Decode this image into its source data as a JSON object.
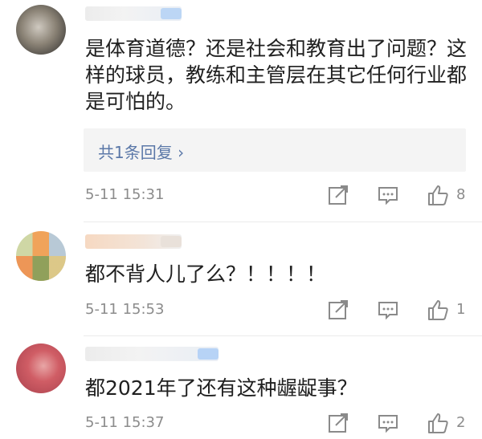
{
  "comments": [
    {
      "text": "是体育道德？还是社会和教育出了问题？这样的球员，教练和主管层在其它任何行业都是可怕的。",
      "reply_link": "共1条回复 ›",
      "time": "5-11 15:31",
      "likes": "8"
    },
    {
      "text": "都不背人儿了么？！！！！",
      "time": "5-11 15:53",
      "likes": "1"
    },
    {
      "text": "都2021年了还有这种龌龊事？",
      "time": "5-11 15:37",
      "likes": "2"
    }
  ],
  "icons": {
    "share": "share-icon",
    "comment": "comment-icon",
    "like": "thumbs-up-icon"
  },
  "colors": {
    "link": "#5b78a8",
    "meta": "#8c8c8c",
    "reply_bg": "#f4f4f4"
  }
}
